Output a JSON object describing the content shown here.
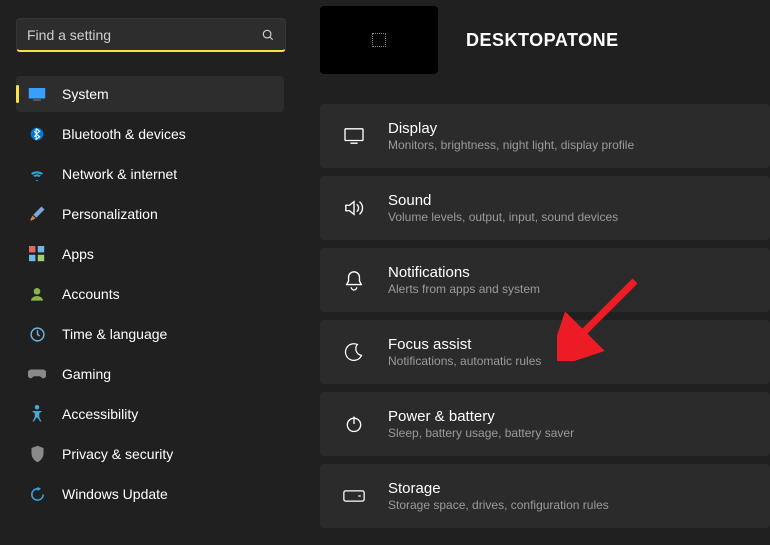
{
  "search": {
    "placeholder": "Find a setting"
  },
  "sidebar": {
    "items": [
      {
        "label": "System",
        "selected": true
      },
      {
        "label": "Bluetooth & devices"
      },
      {
        "label": "Network & internet"
      },
      {
        "label": "Personalization"
      },
      {
        "label": "Apps"
      },
      {
        "label": "Accounts"
      },
      {
        "label": "Time & language"
      },
      {
        "label": "Gaming"
      },
      {
        "label": "Accessibility"
      },
      {
        "label": "Privacy & security"
      },
      {
        "label": "Windows Update"
      }
    ]
  },
  "header": {
    "title": "DESKTOPATONE"
  },
  "panels": [
    {
      "title": "Display",
      "subtitle": "Monitors, brightness, night light, display profile"
    },
    {
      "title": "Sound",
      "subtitle": "Volume levels, output, input, sound devices"
    },
    {
      "title": "Notifications",
      "subtitle": "Alerts from apps and system"
    },
    {
      "title": "Focus assist",
      "subtitle": "Notifications, automatic rules"
    },
    {
      "title": "Power & battery",
      "subtitle": "Sleep, battery usage, battery saver"
    },
    {
      "title": "Storage",
      "subtitle": "Storage space, drives, configuration rules"
    }
  ]
}
